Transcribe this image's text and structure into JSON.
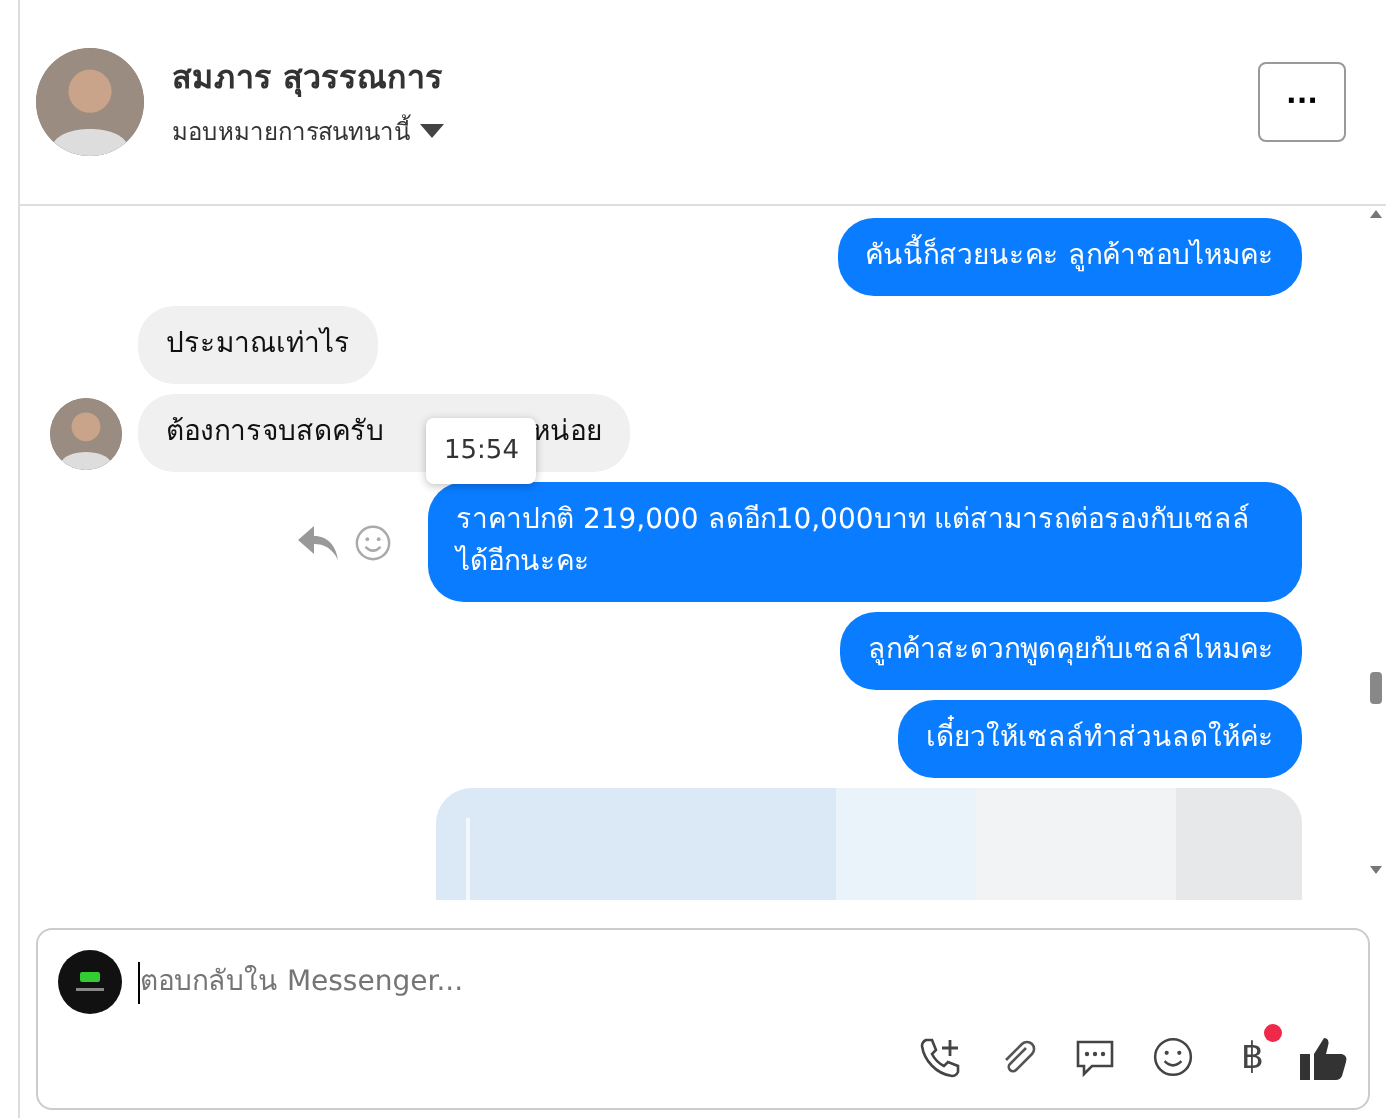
{
  "header": {
    "name": "สมภาร สุวรรณการ",
    "assign": "มอบหมายการสนทนานี้",
    "more": "···"
  },
  "messages": [
    {
      "kind": "out",
      "parts": [
        "คันนี้ก็สวยนะคะ ลูกค้าชอบไหมคะ"
      ]
    },
    {
      "kind": "in",
      "avatar": false,
      "parts": [
        "ประมาณเท่าไร"
      ]
    },
    {
      "kind": "in",
      "avatar": true,
      "parts": [
        "ต้องการจบสดครับ",
        "หน่อย"
      ],
      "tooltip": "15:54"
    },
    {
      "kind": "out",
      "actions": true,
      "parts": [
        "ราคาปกติ 219,000 ลดอีก10,000บาท แต่สามารถต่อรองกับเซลล์ได้อีกนะคะ"
      ]
    },
    {
      "kind": "out",
      "parts": [
        "ลูกค้าสะดวกพูดคุยกับเซลล์ไหมคะ"
      ]
    },
    {
      "kind": "out",
      "parts": [
        "เดี๋ยวให้เซลล์ทำส่วนลดให้ค่ะ"
      ]
    },
    {
      "kind": "picture"
    }
  ],
  "composer": {
    "placeholder": "ตอบกลับใน Messenger...",
    "payment_symbol": "฿",
    "payment_notice": true
  }
}
